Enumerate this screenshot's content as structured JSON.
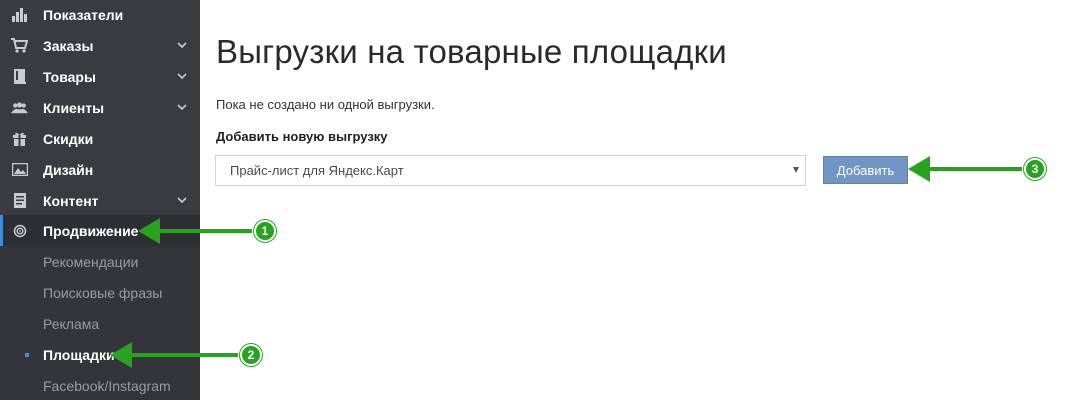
{
  "sidebar": {
    "items": [
      {
        "label": "Показатели",
        "icon": "bar-chart-icon"
      },
      {
        "label": "Заказы",
        "icon": "cart-icon"
      },
      {
        "label": "Товары",
        "icon": "book-icon"
      },
      {
        "label": "Клиенты",
        "icon": "users-icon"
      },
      {
        "label": "Скидки",
        "icon": "gift-icon"
      },
      {
        "label": "Дизайн",
        "icon": "image-icon"
      },
      {
        "label": "Контент",
        "icon": "document-icon"
      },
      {
        "label": "Продвижение",
        "icon": "target-icon"
      }
    ],
    "subitems": [
      {
        "label": "Рекомендации"
      },
      {
        "label": "Поисковые фразы"
      },
      {
        "label": "Реклама"
      },
      {
        "label": "Площадки"
      },
      {
        "label": "Facebook/Instagram"
      }
    ]
  },
  "main": {
    "title": "Выгрузки на товарные площадки",
    "empty_text": "Пока не создано ни одной выгрузки.",
    "add_label": "Добавить новую выгрузку",
    "select_value": "Прайс-лист для Яндекс.Карт",
    "add_button": "Добавить"
  },
  "annotations": {
    "badges": [
      "1",
      "2",
      "3"
    ],
    "arrow_color": "#27a31f"
  },
  "colors": {
    "sidebar_bg": "#393b40",
    "accent": "#3c8dde",
    "button": "#7196c6"
  }
}
